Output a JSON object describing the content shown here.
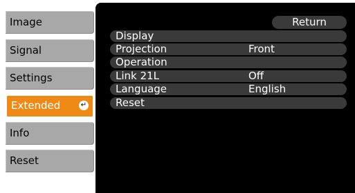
{
  "sidebar": {
    "items": [
      {
        "label": "Image"
      },
      {
        "label": "Signal"
      },
      {
        "label": "Settings"
      },
      {
        "label": "Extended"
      },
      {
        "label": "Info"
      },
      {
        "label": "Reset"
      }
    ],
    "active_index": 3
  },
  "panel": {
    "return_label": "Return",
    "rows": [
      {
        "label": "Display",
        "value": ""
      },
      {
        "label": "Projection",
        "value": "Front"
      },
      {
        "label": "Operation",
        "value": ""
      },
      {
        "label": "Link 21L",
        "value": "Off"
      },
      {
        "label": "Language",
        "value": "English"
      },
      {
        "label": "Reset",
        "value": ""
      }
    ]
  },
  "colors": {
    "active": "#f08a17",
    "inactive": "#a8a8a8",
    "panel": "#000000",
    "row": "#3a3a3a"
  },
  "icons": {
    "active_item_icon": "enter-icon"
  }
}
